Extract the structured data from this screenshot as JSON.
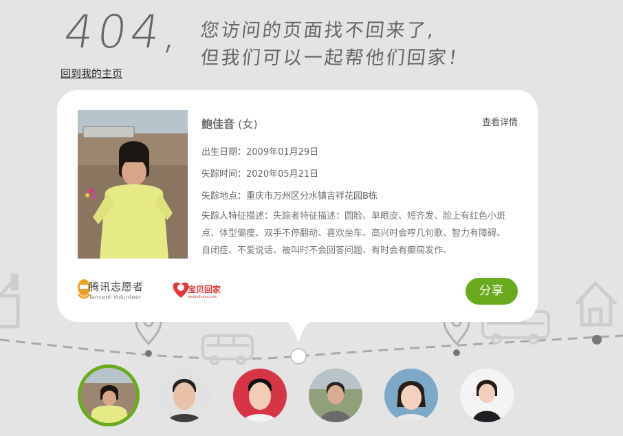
{
  "header": {
    "code": "404,",
    "line1": "您访问的页面找不回来了,",
    "line2": "但我们可以一起帮他们回家！",
    "home_link": "回到我的主页"
  },
  "card": {
    "name": "鲍佳音",
    "gender": "(女)",
    "details_link": "查看详情",
    "birth_label": "出生日期：",
    "birth_value": "2009年01月29日",
    "missing_time_label": "失踪时间：",
    "missing_time_value": "2020年05月21日",
    "missing_place_label": "失踪地点：",
    "missing_place_value": "重庆市万州区分水镇吉祥花园B栋",
    "desc_label": "失踪人特征描述：",
    "desc_value": "失踪者特征描述：圆脸、单眼皮、短齐发、脸上有红色小斑点、体型偏瘦、双手不停翻动、喜欢坐车、高兴时会哼几句歌、智力有障碍、自闭症、不爱说话、被叫时不会回答问题、有时会有癫痫发作、",
    "share_label": "分享"
  },
  "logos": {
    "tencent_cn": "腾讯志愿者",
    "tencent_en": "Tencent Volunteer",
    "baobei": "宝贝回家",
    "baobei_small": "baobeihuijia.com"
  },
  "carousel": {
    "active_index": 0,
    "items": [
      "avatar-1",
      "avatar-2",
      "avatar-3",
      "avatar-4",
      "avatar-5",
      "avatar-6"
    ]
  },
  "colors": {
    "background": "#e4e4e4",
    "accent_green": "#6aaa1e",
    "line_gray": "#a9a9a9",
    "baobei_red": "#e0393e"
  }
}
